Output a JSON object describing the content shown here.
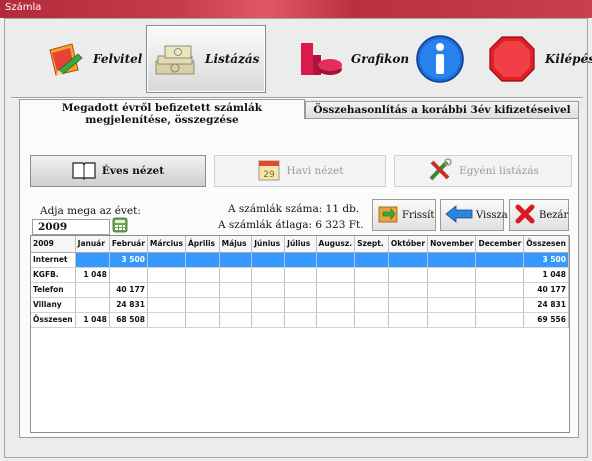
{
  "window": {
    "title": "Számla"
  },
  "toolbar": {
    "felvitel": "Felvitel",
    "listazas": "Listázás",
    "grafikon": "Grafikon",
    "kilepes": "Kilépés"
  },
  "tabs": [
    {
      "label": "Megadott évről befizetett számlák megjelenítése, összegzése",
      "active": true
    },
    {
      "label": "Összehasonlítás a korábbi 3év kifizetéseivel",
      "active": false
    }
  ],
  "views": {
    "eves": "Éves nézet",
    "havi": "Havi nézet",
    "havi_calendar_day": "29",
    "egyeni": "Egyéni listázás"
  },
  "year_panel": {
    "label": "Adja mega az évet:",
    "value": "2009"
  },
  "stats": {
    "count_line": "A számlák száma: 11 db.",
    "avg_line": "A számlák átlaga:  6 323 Ft."
  },
  "actions": {
    "frissit": "Frissít",
    "vissza": "Vissza",
    "bezar": "Bezár"
  },
  "table": {
    "columns": [
      "2009",
      "Január",
      "Február",
      "Március",
      "Április",
      "Május",
      "Június",
      "Július",
      "Augusz.",
      "Szept.",
      "Október",
      "November",
      "December",
      "Összesen"
    ],
    "rows": [
      {
        "label": "Internet",
        "cells": [
          "",
          "3 500",
          "",
          "",
          "",
          "",
          "",
          "",
          "",
          "",
          "",
          "",
          "3 500"
        ],
        "selected": true
      },
      {
        "label": "KGFB.",
        "cells": [
          "1 048",
          "",
          "",
          "",
          "",
          "",
          "",
          "",
          "",
          "",
          "",
          "",
          "1 048"
        ],
        "selected": false
      },
      {
        "label": "Telefon",
        "cells": [
          "",
          "40 177",
          "",
          "",
          "",
          "",
          "",
          "",
          "",
          "",
          "",
          "",
          "40 177"
        ],
        "selected": false
      },
      {
        "label": "Villany",
        "cells": [
          "",
          "24 831",
          "",
          "",
          "",
          "",
          "",
          "",
          "",
          "",
          "",
          "",
          "24 831"
        ],
        "selected": false
      },
      {
        "label": "Összesen",
        "cells": [
          "1 048",
          "68 508",
          "",
          "",
          "",
          "",
          "",
          "",
          "",
          "",
          "",
          "",
          "69 556"
        ],
        "selected": false
      }
    ]
  },
  "colors": {
    "selection": "#3399ff",
    "titlebar": "#b42a3a"
  }
}
